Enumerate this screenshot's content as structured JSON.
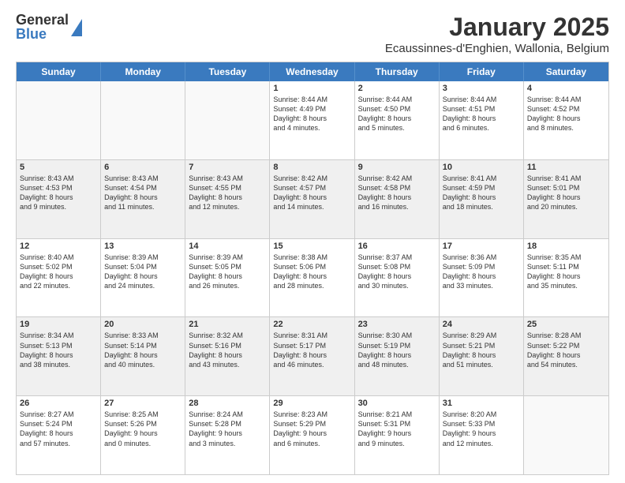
{
  "logo": {
    "general": "General",
    "blue": "Blue"
  },
  "title": "January 2025",
  "subtitle": "Ecaussinnes-d'Enghien, Wallonia, Belgium",
  "days": [
    "Sunday",
    "Monday",
    "Tuesday",
    "Wednesday",
    "Thursday",
    "Friday",
    "Saturday"
  ],
  "rows": [
    [
      {
        "num": "",
        "lines": []
      },
      {
        "num": "",
        "lines": []
      },
      {
        "num": "",
        "lines": []
      },
      {
        "num": "1",
        "lines": [
          "Sunrise: 8:44 AM",
          "Sunset: 4:49 PM",
          "Daylight: 8 hours",
          "and 4 minutes."
        ]
      },
      {
        "num": "2",
        "lines": [
          "Sunrise: 8:44 AM",
          "Sunset: 4:50 PM",
          "Daylight: 8 hours",
          "and 5 minutes."
        ]
      },
      {
        "num": "3",
        "lines": [
          "Sunrise: 8:44 AM",
          "Sunset: 4:51 PM",
          "Daylight: 8 hours",
          "and 6 minutes."
        ]
      },
      {
        "num": "4",
        "lines": [
          "Sunrise: 8:44 AM",
          "Sunset: 4:52 PM",
          "Daylight: 8 hours",
          "and 8 minutes."
        ]
      }
    ],
    [
      {
        "num": "5",
        "lines": [
          "Sunrise: 8:43 AM",
          "Sunset: 4:53 PM",
          "Daylight: 8 hours",
          "and 9 minutes."
        ]
      },
      {
        "num": "6",
        "lines": [
          "Sunrise: 8:43 AM",
          "Sunset: 4:54 PM",
          "Daylight: 8 hours",
          "and 11 minutes."
        ]
      },
      {
        "num": "7",
        "lines": [
          "Sunrise: 8:43 AM",
          "Sunset: 4:55 PM",
          "Daylight: 8 hours",
          "and 12 minutes."
        ]
      },
      {
        "num": "8",
        "lines": [
          "Sunrise: 8:42 AM",
          "Sunset: 4:57 PM",
          "Daylight: 8 hours",
          "and 14 minutes."
        ]
      },
      {
        "num": "9",
        "lines": [
          "Sunrise: 8:42 AM",
          "Sunset: 4:58 PM",
          "Daylight: 8 hours",
          "and 16 minutes."
        ]
      },
      {
        "num": "10",
        "lines": [
          "Sunrise: 8:41 AM",
          "Sunset: 4:59 PM",
          "Daylight: 8 hours",
          "and 18 minutes."
        ]
      },
      {
        "num": "11",
        "lines": [
          "Sunrise: 8:41 AM",
          "Sunset: 5:01 PM",
          "Daylight: 8 hours",
          "and 20 minutes."
        ]
      }
    ],
    [
      {
        "num": "12",
        "lines": [
          "Sunrise: 8:40 AM",
          "Sunset: 5:02 PM",
          "Daylight: 8 hours",
          "and 22 minutes."
        ]
      },
      {
        "num": "13",
        "lines": [
          "Sunrise: 8:39 AM",
          "Sunset: 5:04 PM",
          "Daylight: 8 hours",
          "and 24 minutes."
        ]
      },
      {
        "num": "14",
        "lines": [
          "Sunrise: 8:39 AM",
          "Sunset: 5:05 PM",
          "Daylight: 8 hours",
          "and 26 minutes."
        ]
      },
      {
        "num": "15",
        "lines": [
          "Sunrise: 8:38 AM",
          "Sunset: 5:06 PM",
          "Daylight: 8 hours",
          "and 28 minutes."
        ]
      },
      {
        "num": "16",
        "lines": [
          "Sunrise: 8:37 AM",
          "Sunset: 5:08 PM",
          "Daylight: 8 hours",
          "and 30 minutes."
        ]
      },
      {
        "num": "17",
        "lines": [
          "Sunrise: 8:36 AM",
          "Sunset: 5:09 PM",
          "Daylight: 8 hours",
          "and 33 minutes."
        ]
      },
      {
        "num": "18",
        "lines": [
          "Sunrise: 8:35 AM",
          "Sunset: 5:11 PM",
          "Daylight: 8 hours",
          "and 35 minutes."
        ]
      }
    ],
    [
      {
        "num": "19",
        "lines": [
          "Sunrise: 8:34 AM",
          "Sunset: 5:13 PM",
          "Daylight: 8 hours",
          "and 38 minutes."
        ]
      },
      {
        "num": "20",
        "lines": [
          "Sunrise: 8:33 AM",
          "Sunset: 5:14 PM",
          "Daylight: 8 hours",
          "and 40 minutes."
        ]
      },
      {
        "num": "21",
        "lines": [
          "Sunrise: 8:32 AM",
          "Sunset: 5:16 PM",
          "Daylight: 8 hours",
          "and 43 minutes."
        ]
      },
      {
        "num": "22",
        "lines": [
          "Sunrise: 8:31 AM",
          "Sunset: 5:17 PM",
          "Daylight: 8 hours",
          "and 46 minutes."
        ]
      },
      {
        "num": "23",
        "lines": [
          "Sunrise: 8:30 AM",
          "Sunset: 5:19 PM",
          "Daylight: 8 hours",
          "and 48 minutes."
        ]
      },
      {
        "num": "24",
        "lines": [
          "Sunrise: 8:29 AM",
          "Sunset: 5:21 PM",
          "Daylight: 8 hours",
          "and 51 minutes."
        ]
      },
      {
        "num": "25",
        "lines": [
          "Sunrise: 8:28 AM",
          "Sunset: 5:22 PM",
          "Daylight: 8 hours",
          "and 54 minutes."
        ]
      }
    ],
    [
      {
        "num": "26",
        "lines": [
          "Sunrise: 8:27 AM",
          "Sunset: 5:24 PM",
          "Daylight: 8 hours",
          "and 57 minutes."
        ]
      },
      {
        "num": "27",
        "lines": [
          "Sunrise: 8:25 AM",
          "Sunset: 5:26 PM",
          "Daylight: 9 hours",
          "and 0 minutes."
        ]
      },
      {
        "num": "28",
        "lines": [
          "Sunrise: 8:24 AM",
          "Sunset: 5:28 PM",
          "Daylight: 9 hours",
          "and 3 minutes."
        ]
      },
      {
        "num": "29",
        "lines": [
          "Sunrise: 8:23 AM",
          "Sunset: 5:29 PM",
          "Daylight: 9 hours",
          "and 6 minutes."
        ]
      },
      {
        "num": "30",
        "lines": [
          "Sunrise: 8:21 AM",
          "Sunset: 5:31 PM",
          "Daylight: 9 hours",
          "and 9 minutes."
        ]
      },
      {
        "num": "31",
        "lines": [
          "Sunrise: 8:20 AM",
          "Sunset: 5:33 PM",
          "Daylight: 9 hours",
          "and 12 minutes."
        ]
      },
      {
        "num": "",
        "lines": []
      }
    ]
  ]
}
